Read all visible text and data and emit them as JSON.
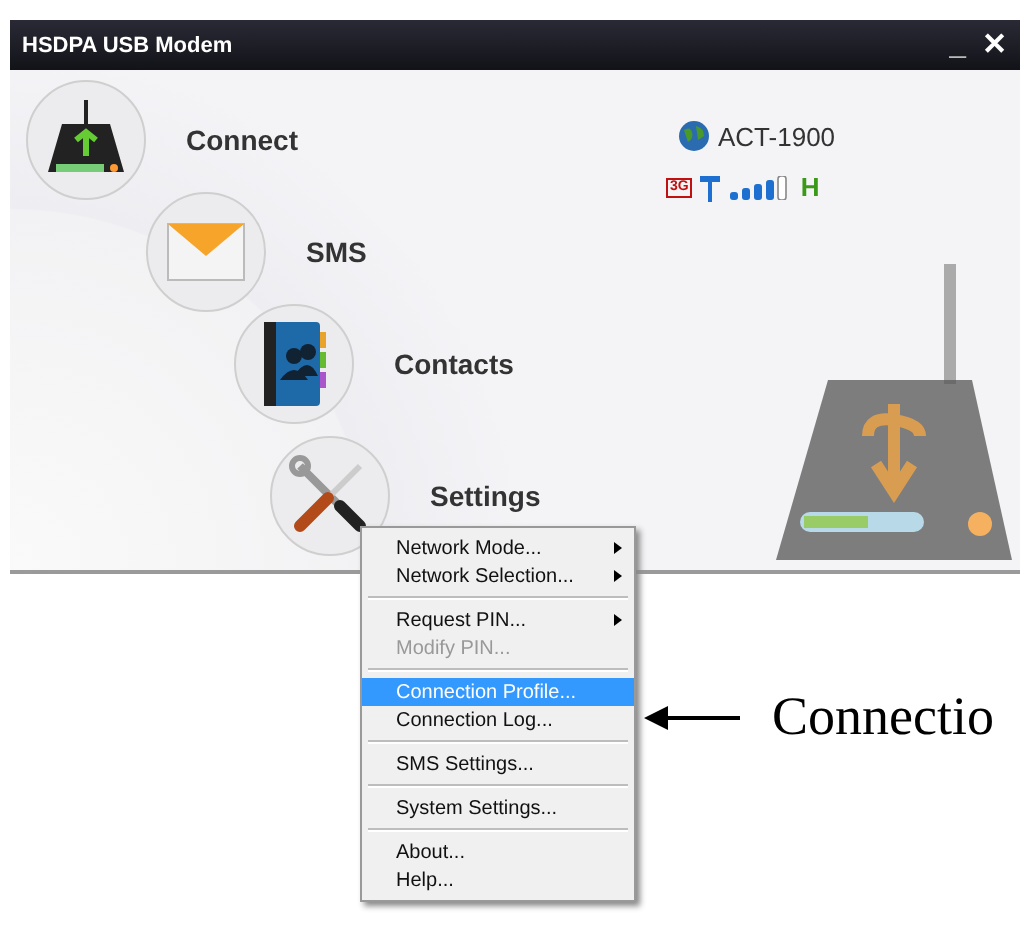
{
  "window": {
    "title": "HSDPA USB Modem",
    "controls": [
      "_",
      "✕"
    ]
  },
  "nav": [
    {
      "label": "Connect",
      "kind": "connect"
    },
    {
      "label": "SMS",
      "kind": "sms"
    },
    {
      "label": "Contacts",
      "kind": "contacts"
    },
    {
      "label": "Settings",
      "kind": "settings"
    }
  ],
  "status": {
    "operator": "ACT-1900",
    "network": "3G",
    "mode": "H"
  },
  "menu": [
    {
      "kind": "item",
      "label": "Network Mode...",
      "submenu": true,
      "disabled": false,
      "selected": false
    },
    {
      "kind": "item",
      "label": "Network Selection...",
      "submenu": true,
      "disabled": false,
      "selected": false
    },
    {
      "kind": "separator"
    },
    {
      "kind": "item",
      "label": "Request PIN...",
      "submenu": true,
      "disabled": false,
      "selected": false
    },
    {
      "kind": "item",
      "label": "Modify PIN...",
      "submenu": false,
      "disabled": true,
      "selected": false
    },
    {
      "kind": "separator"
    },
    {
      "kind": "item",
      "label": "Connection Profile...",
      "submenu": false,
      "disabled": false,
      "selected": true
    },
    {
      "kind": "item",
      "label": "Connection Log...",
      "submenu": false,
      "disabled": false,
      "selected": false
    },
    {
      "kind": "separator"
    },
    {
      "kind": "item",
      "label": "SMS Settings...",
      "submenu": false,
      "disabled": false,
      "selected": false
    },
    {
      "kind": "separator"
    },
    {
      "kind": "item",
      "label": "System Settings...",
      "submenu": false,
      "disabled": false,
      "selected": false
    },
    {
      "kind": "separator"
    },
    {
      "kind": "item",
      "label": "About...",
      "submenu": false,
      "disabled": false,
      "selected": false
    },
    {
      "kind": "item",
      "label": "Help...",
      "submenu": false,
      "disabled": false,
      "selected": false
    }
  ],
  "annotation": {
    "text": "Connectio"
  }
}
